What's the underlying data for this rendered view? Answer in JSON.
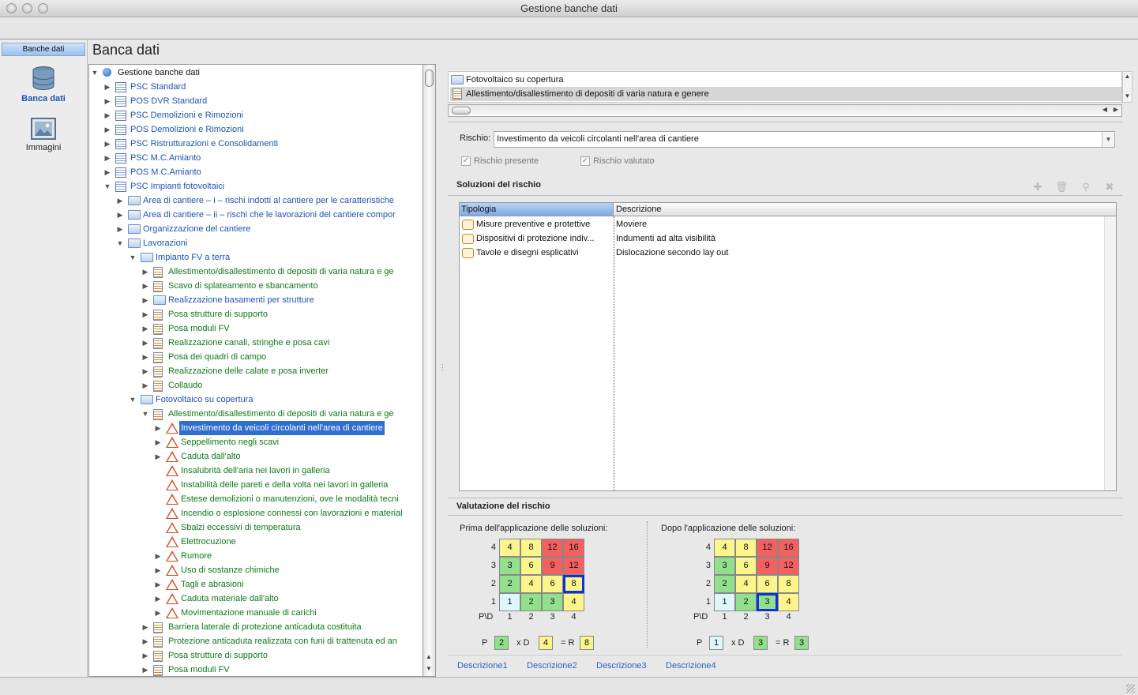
{
  "window": {
    "title": "Gestione banche dati"
  },
  "nav": {
    "header": "Banche dati",
    "items": [
      {
        "label": "Banca dati",
        "icon": "database-icon",
        "active": true
      },
      {
        "label": "Immagini",
        "icon": "image-icon",
        "active": false
      }
    ]
  },
  "page": {
    "title": "Banca dati"
  },
  "tree": {
    "rows": [
      {
        "label": "Gestione banche dati",
        "level": 0,
        "toggle": "open",
        "icon": "globe",
        "color": "dark"
      },
      {
        "label": "PSC Standard",
        "level": 1,
        "toggle": "closed",
        "icon": "list",
        "color": "blue"
      },
      {
        "label": "POS DVR  Standard",
        "level": 1,
        "toggle": "closed",
        "icon": "list",
        "color": "blue"
      },
      {
        "label": "PSC Demolizioni e Rimozioni",
        "level": 1,
        "toggle": "closed",
        "icon": "list",
        "color": "blue"
      },
      {
        "label": "POS Demolizioni e Rimozioni",
        "level": 1,
        "toggle": "closed",
        "icon": "list",
        "color": "blue"
      },
      {
        "label": "PSC Ristrutturazioni e Consolidamenti",
        "level": 1,
        "toggle": "closed",
        "icon": "list",
        "color": "blue"
      },
      {
        "label": "PSC M.C.Amianto",
        "level": 1,
        "toggle": "closed",
        "icon": "list",
        "color": "blue"
      },
      {
        "label": "POS M.C.Amianto",
        "level": 1,
        "toggle": "closed",
        "icon": "list",
        "color": "blue"
      },
      {
        "label": "PSC Impianti fotovoltaici",
        "level": 1,
        "toggle": "open",
        "icon": "list",
        "color": "blue"
      },
      {
        "label": "Area di cantiere – i – rischi indotti al cantiere per le caratteristiche",
        "level": 2,
        "toggle": "closed",
        "icon": "folder",
        "color": "blue"
      },
      {
        "label": "Area di cantiere – ii – rischi che le lavorazioni del cantiere compor",
        "level": 2,
        "toggle": "closed",
        "icon": "folder",
        "color": "blue"
      },
      {
        "label": "Organizzazione del cantiere",
        "level": 2,
        "toggle": "closed",
        "icon": "folder",
        "color": "blue"
      },
      {
        "label": "Lavorazioni",
        "level": 2,
        "toggle": "open",
        "icon": "folder",
        "color": "blue"
      },
      {
        "label": "Impianto FV a terra",
        "level": 3,
        "toggle": "open",
        "icon": "folder",
        "color": "blue"
      },
      {
        "label": "Allestimento/disallestimento di depositi di varia natura e ge",
        "level": 4,
        "toggle": "closed",
        "icon": "doc",
        "color": "green"
      },
      {
        "label": "Scavo di splateamento e sbancamento",
        "level": 4,
        "toggle": "closed",
        "icon": "doc",
        "color": "green"
      },
      {
        "label": "Realizzazione basamenti per strutture",
        "level": 4,
        "toggle": "closed",
        "icon": "folder",
        "color": "blue"
      },
      {
        "label": "Posa strutture di supporto",
        "level": 4,
        "toggle": "closed",
        "icon": "doc",
        "color": "green"
      },
      {
        "label": "Posa moduli FV",
        "level": 4,
        "toggle": "closed",
        "icon": "doc",
        "color": "green"
      },
      {
        "label": "Realizzazione canali, stringhe e posa cavi",
        "level": 4,
        "toggle": "closed",
        "icon": "doc",
        "color": "green"
      },
      {
        "label": "Posa dei quadri di campo",
        "level": 4,
        "toggle": "closed",
        "icon": "doc",
        "color": "green"
      },
      {
        "label": "Realizzazione delle calate e posa inverter",
        "level": 4,
        "toggle": "closed",
        "icon": "doc",
        "color": "green"
      },
      {
        "label": "Collaudo",
        "level": 4,
        "toggle": "closed",
        "icon": "doc",
        "color": "green"
      },
      {
        "label": "Fotovoltaico su copertura",
        "level": 3,
        "toggle": "open",
        "icon": "folder",
        "color": "blue"
      },
      {
        "label": "Allestimento/disallestimento di depositi di varia natura e ge",
        "level": 4,
        "toggle": "open",
        "icon": "doc",
        "color": "green"
      },
      {
        "label": "Investimento da veicoli circolanti nell'area di cantiere",
        "level": 5,
        "toggle": "closed",
        "icon": "warn",
        "color": "green",
        "selected": true
      },
      {
        "label": "Seppellimento negli scavi",
        "level": 5,
        "toggle": "closed",
        "icon": "warn",
        "color": "green"
      },
      {
        "label": "Caduta dall'alto",
        "level": 5,
        "toggle": "closed",
        "icon": "warn",
        "color": "green"
      },
      {
        "label": "Insalubrità dell'aria nei lavori in galleria",
        "level": 5,
        "toggle": "none",
        "icon": "warn",
        "color": "green"
      },
      {
        "label": "Instabilità delle pareti e della volta nei lavori in galleria",
        "level": 5,
        "toggle": "none",
        "icon": "warn",
        "color": "green"
      },
      {
        "label": "Estese demolizioni o manutenzioni, ove le modalità tecni",
        "level": 5,
        "toggle": "none",
        "icon": "warn",
        "color": "green"
      },
      {
        "label": "Incendio o esplosione connessi con lavorazioni e material",
        "level": 5,
        "toggle": "none",
        "icon": "warn",
        "color": "green"
      },
      {
        "label": "Sbalzi eccessivi di temperatura",
        "level": 5,
        "toggle": "none",
        "icon": "warn",
        "color": "green"
      },
      {
        "label": "Elettrocuzione",
        "level": 5,
        "toggle": "none",
        "icon": "warn",
        "color": "green"
      },
      {
        "label": "Rumore",
        "level": 5,
        "toggle": "closed",
        "icon": "warn",
        "color": "green"
      },
      {
        "label": "Uso di sostanze chimiche",
        "level": 5,
        "toggle": "closed",
        "icon": "warn",
        "color": "green"
      },
      {
        "label": "Tagli e abrasioni",
        "level": 5,
        "toggle": "closed",
        "icon": "warn",
        "color": "green"
      },
      {
        "label": "Caduta materiale dall'alto",
        "level": 5,
        "toggle": "closed",
        "icon": "warn",
        "color": "green"
      },
      {
        "label": "Movimentazione manuale di carichi",
        "level": 5,
        "toggle": "closed",
        "icon": "warn",
        "color": "green"
      },
      {
        "label": "Barriera laterale di protezione anticaduta costituita",
        "level": 4,
        "toggle": "closed",
        "icon": "doc",
        "color": "green"
      },
      {
        "label": "Protezione anticaduta realizzata con funi di trattenuta ed an",
        "level": 4,
        "toggle": "closed",
        "icon": "doc",
        "color": "green"
      },
      {
        "label": "Posa strutture di supporto",
        "level": 4,
        "toggle": "closed",
        "icon": "doc",
        "color": "green"
      },
      {
        "label": "Posa moduli FV",
        "level": 4,
        "toggle": "closed",
        "icon": "doc",
        "color": "green"
      }
    ]
  },
  "breadcrumb": {
    "items": [
      {
        "label": "Fotovoltaico su copertura",
        "icon": "folder"
      },
      {
        "label": "Allestimento/disallestimento di depositi di varia natura e genere",
        "icon": "doc",
        "active": true
      }
    ]
  },
  "risk": {
    "label": "Rischio:",
    "value": "Investimento da veicoli circolanti nell'area di cantiere",
    "present_label": "Rischio presente",
    "present_checked": true,
    "evaluated_label": "Rischio valutato",
    "evaluated_checked": true
  },
  "solutions": {
    "title": "Soluzioni del rischio",
    "columns": [
      "Tipologia",
      "Descrizione"
    ],
    "rows": [
      {
        "type": "Misure preventive e protettive",
        "desc": "Moviere"
      },
      {
        "type": "Dispositivi di protezione indiv...",
        "desc": "Indumenti ad alta visibilità"
      },
      {
        "type": "Tavole e disegni esplicativi",
        "desc": "Dislocazione secondo lay out"
      }
    ]
  },
  "evaluation": {
    "title": "Valutazione del rischio",
    "before": {
      "label": "Prima dell'applicazione delle soluzioni:",
      "P": "2",
      "D": "4",
      "R": "8",
      "sel_row": 2,
      "sel_col": 4
    },
    "after": {
      "label": "Dopo l'applicazione delle soluzioni:",
      "P": "1",
      "D": "3",
      "R": "3",
      "sel_row": 1,
      "sel_col": 3
    },
    "row_labels": [
      "4",
      "3",
      "2",
      "1"
    ],
    "col_labels": [
      "1",
      "2",
      "3",
      "4"
    ],
    "corner": "P\\D",
    "matrix": [
      [
        "4",
        "8",
        "12",
        "16"
      ],
      [
        "3",
        "6",
        "9",
        "12"
      ],
      [
        "2",
        "4",
        "6",
        "8"
      ],
      [
        "1",
        "2",
        "3",
        "4"
      ]
    ],
    "p_label": "P",
    "d_label": "x D",
    "r_label": "= R",
    "colors": {
      "red": "#f26060",
      "yellow": "#fbf58c",
      "green": "#92e08c",
      "lightblue": "#dff7fb",
      "selection": "#1030d8"
    }
  },
  "tabs": [
    "Descrizione1",
    "Descrizione2",
    "Descrizione3",
    "Descrizione4"
  ]
}
